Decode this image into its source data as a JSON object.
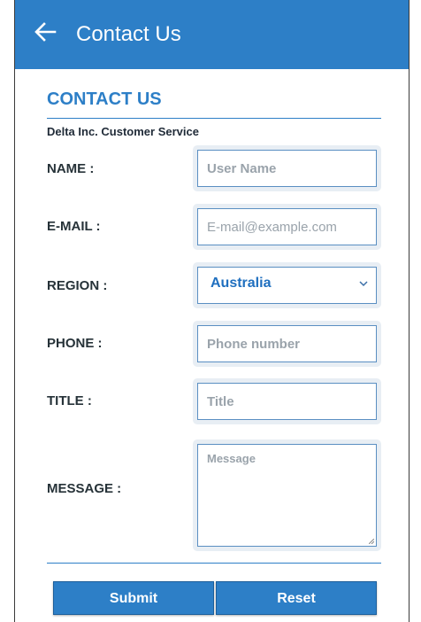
{
  "appbar": {
    "title": "Contact Us",
    "back_icon": "arrow-left-icon",
    "color": "#2d7fc7"
  },
  "form": {
    "heading": "CONTACT US",
    "subtitle": "Delta Inc. Customer Service",
    "name": {
      "label": "NAME :",
      "placeholder": "User Name",
      "value": ""
    },
    "email": {
      "label": "E-MAIL :",
      "placeholder": "E-mail@example.com",
      "value": ""
    },
    "region": {
      "label": "REGION :",
      "selected": "Australia",
      "icon": "chevron-down-icon"
    },
    "phone": {
      "label": "PHONE :",
      "placeholder": "Phone number",
      "value": ""
    },
    "title": {
      "label": "TITLE :",
      "placeholder": "Title",
      "value": ""
    },
    "message": {
      "label": "MESSAGE :",
      "placeholder": "Message",
      "value": ""
    }
  },
  "buttons": {
    "submit": "Submit",
    "reset": "Reset"
  }
}
